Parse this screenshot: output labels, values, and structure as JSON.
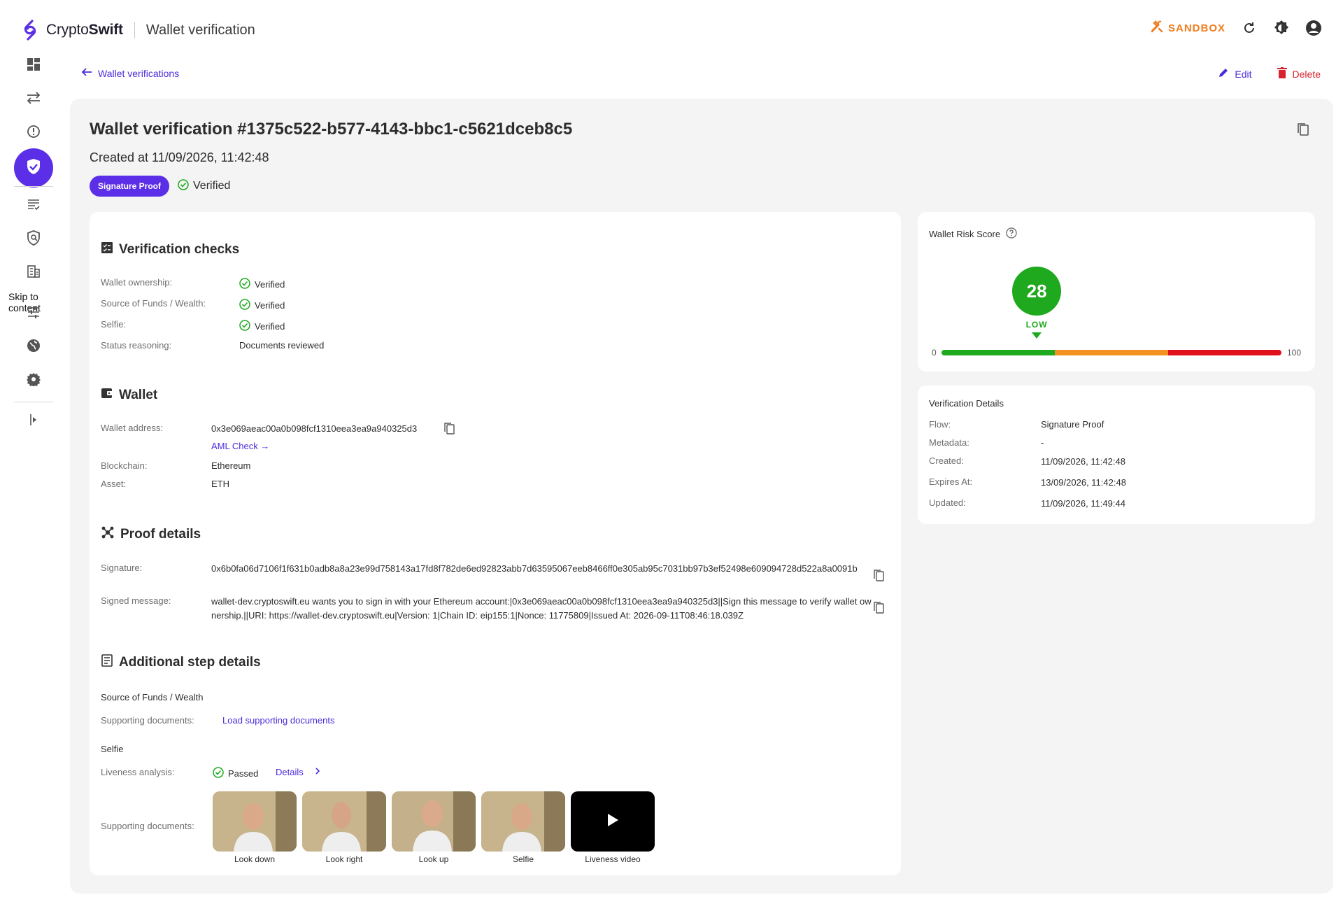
{
  "app": {
    "brand_prefix": "Crypto",
    "brand_suffix": "Swift",
    "page_name": "Wallet verification",
    "sandbox_label": "SANDBOX",
    "accent_color": "#5b2ee8",
    "sandbox_color": "#ef7d1e"
  },
  "sidebar": {
    "skip_label": "Skip to content",
    "items": [
      {
        "icon": "dashboard-icon"
      },
      {
        "icon": "transfers-icon"
      },
      {
        "icon": "alert-icon"
      },
      {
        "icon": "shield-check-icon",
        "active": true
      },
      {
        "icon": "list-check-icon"
      },
      {
        "icon": "shield-search-icon"
      },
      {
        "icon": "building-icon"
      },
      {
        "icon": "sliders-icon"
      },
      {
        "icon": "globe-icon"
      },
      {
        "icon": "gear-icon"
      },
      {
        "icon": "collapse-icon"
      }
    ]
  },
  "breadcrumb": {
    "back_label": "Wallet verifications"
  },
  "actions": {
    "edit_label": "Edit",
    "delete_label": "Delete"
  },
  "header": {
    "title": "Wallet verification #1375c522-b577-4143-bbc1-c5621dceb8c5",
    "created": "Created at 11/09/2026, 11:42:48",
    "flow_badge": "Signature Proof",
    "status": "Verified"
  },
  "checks": {
    "heading": "Verification checks",
    "rows": [
      {
        "label": "Wallet ownership:",
        "value": "Verified"
      },
      {
        "label": "Source of Funds / Wealth:",
        "value": "Verified"
      },
      {
        "label": "Selfie:",
        "value": "Verified"
      }
    ],
    "reasoning_label": "Status reasoning:",
    "reasoning_value": "Documents reviewed"
  },
  "wallet": {
    "heading": "Wallet",
    "address_label": "Wallet address:",
    "address": "0x3e069aeac00a0b098fcf1310eea3ea9a940325d3",
    "aml_link": "AML Check →",
    "blockchain_label": "Blockchain:",
    "blockchain": "Ethereum",
    "asset_label": "Asset:",
    "asset": "ETH"
  },
  "proof": {
    "heading": "Proof details",
    "signature_label": "Signature:",
    "signature": "0x6b0fa06d7106f1f631b0adb8a8a23e99d758143a17fd8f782de6ed92823abb7d63595067eeb8466ff0e305ab95c7031bb97b3ef52498e609094728d522a8a0091b",
    "message_label": "Signed message:",
    "message": "wallet-dev.cryptoswift.eu wants you to sign in with your Ethereum account:|0x3e069aeac00a0b098fcf1310eea3ea9a940325d3||Sign this message to verify wallet ownership.||URI: https://wallet-dev.cryptoswift.eu|Version: 1|Chain ID: eip155:1|Nonce: 11775809|Issued At: 2026-09-11T08:46:18.039Z"
  },
  "additional": {
    "heading": "Additional step details",
    "sof_title": "Source of Funds / Wealth",
    "sof_docs_label": "Supporting documents:",
    "sof_docs_link": "Load supporting documents",
    "selfie_title": "Selfie",
    "liveness_label": "Liveness analysis:",
    "liveness_value": "Passed",
    "liveness_details": "Details",
    "selfie_docs_label": "Supporting documents:",
    "thumbnails": [
      {
        "caption": "Look down"
      },
      {
        "caption": "Look right"
      },
      {
        "caption": "Look up"
      },
      {
        "caption": "Selfie"
      },
      {
        "caption": "Liveness video"
      }
    ]
  },
  "risk": {
    "title": "Wallet Risk Score",
    "score": "28",
    "score_value": 28,
    "level": "LOW",
    "min": "0",
    "max": "100",
    "colors": {
      "low": "#1fa91f",
      "medium": "#f39220",
      "high": "#e0101d"
    }
  },
  "details": {
    "title": "Verification Details",
    "rows": [
      {
        "label": "Flow:",
        "value": "Signature Proof"
      },
      {
        "label": "Metadata:",
        "value": "-"
      },
      {
        "label": "Created:",
        "value": "11/09/2026, 11:42:48"
      },
      {
        "label": "Expires At:",
        "value": "13/09/2026, 11:42:48"
      },
      {
        "label": "Updated:",
        "value": "11/09/2026, 11:49:44"
      }
    ]
  }
}
